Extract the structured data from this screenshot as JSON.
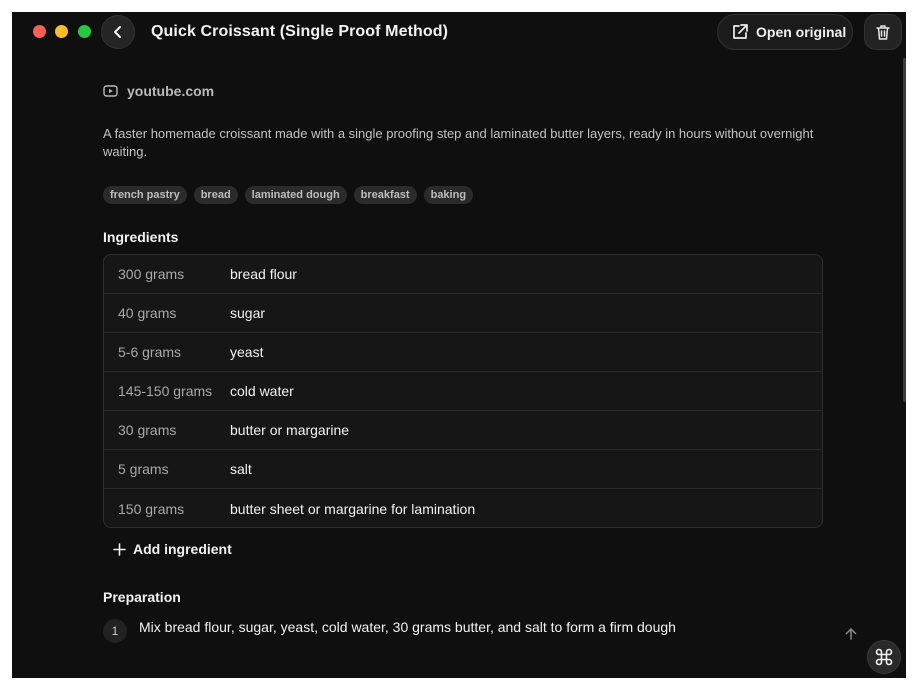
{
  "window": {
    "title": "Quick Croissant (Single Proof Method)",
    "open_original_label": "Open original"
  },
  "recipe": {
    "source": "youtube.com",
    "description": "A faster homemade croissant made with a single proofing step and laminated butter layers, ready in hours without overnight waiting.",
    "tags": [
      "french pastry",
      "bread",
      "laminated dough",
      "breakfast",
      "baking"
    ]
  },
  "ingredients": {
    "title": "Ingredients",
    "items": [
      {
        "qty": "300 grams",
        "name": "bread flour"
      },
      {
        "qty": "40 grams",
        "name": "sugar"
      },
      {
        "qty": "5-6 grams",
        "name": "yeast"
      },
      {
        "qty": "145-150 grams",
        "name": "cold water"
      },
      {
        "qty": "30 grams",
        "name": "butter or margarine"
      },
      {
        "qty": "5 grams",
        "name": "salt"
      },
      {
        "qty": "150 grams",
        "name": "butter sheet or margarine for lamination"
      }
    ],
    "add_label": "Add ingredient"
  },
  "preparation": {
    "title": "Preparation",
    "steps": [
      {
        "number": "1",
        "text": "Mix bread flour, sugar, yeast, cold water, 30 grams butter, and salt to form a firm dough"
      }
    ]
  },
  "icons": {
    "back": "chevron-left-icon",
    "open_original": "external-link-icon",
    "delete": "trash-icon",
    "source": "video-play-icon",
    "add": "plus-icon",
    "scroll_top": "arrow-up-icon",
    "fab": "command-icon"
  },
  "colors": {
    "background": "#0f0f0f",
    "close": "#fe5f57",
    "minimize": "#febc2e",
    "maximize": "#28c840"
  }
}
